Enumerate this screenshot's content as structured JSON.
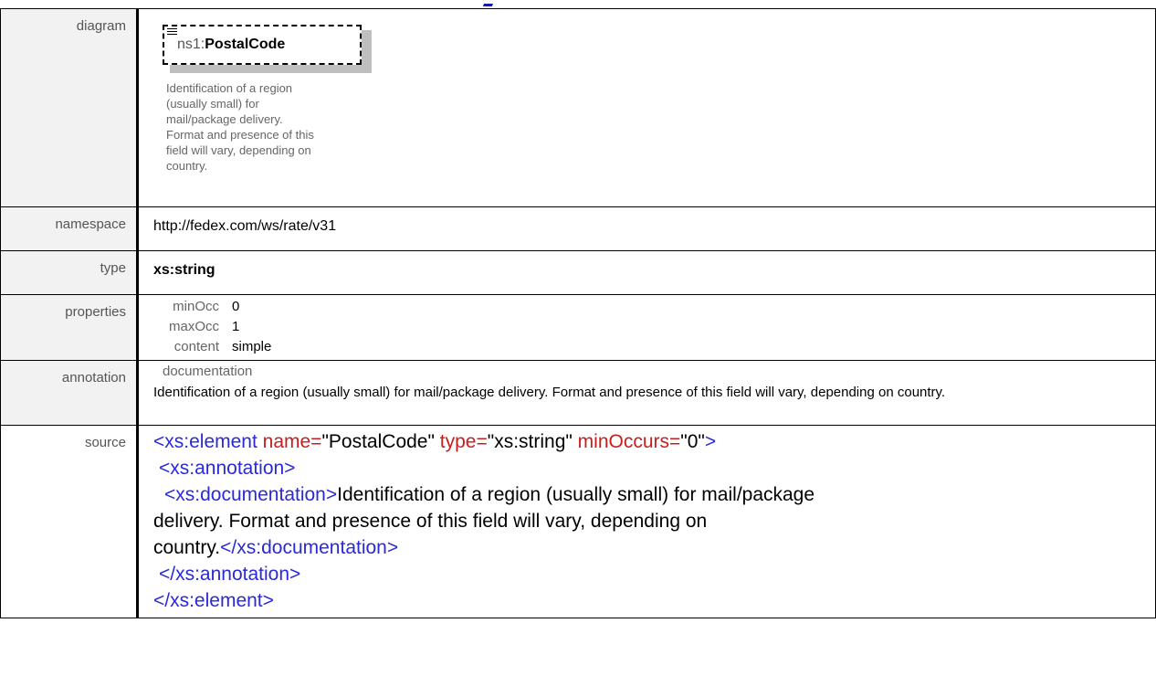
{
  "rows": {
    "diagram": {
      "label": "diagram"
    },
    "namespace": {
      "label": "namespace",
      "value": "http://fedex.com/ws/rate/v31"
    },
    "type": {
      "label": "type",
      "value": "xs:string"
    },
    "properties": {
      "label": "properties",
      "items": [
        {
          "key": "minOcc",
          "value": "0"
        },
        {
          "key": "maxOcc",
          "value": "1"
        },
        {
          "key": "content",
          "value": "simple"
        }
      ]
    },
    "annotation": {
      "label": "annotation",
      "key": "documentation",
      "text": "Identification of a region (usually small) for mail/package delivery. Format and presence of this field will vary, depending on country."
    },
    "source": {
      "label": "source"
    }
  },
  "diagram": {
    "ns_prefix": "ns1:",
    "name": "PostalCode",
    "doc_lines": [
      "Identification of a region",
      "(usually small) for",
      "mail/package delivery.",
      "Format and presence of this",
      "field will vary, depending on",
      "country."
    ]
  },
  "source": {
    "line1": {
      "open": "<xs:element",
      "attr1": " name=",
      "val1": "\"PostalCode\"",
      "attr2": " type=",
      "val2": "\"xs:string\"",
      "attr3": " minOccurs=",
      "val3": "\"0\"",
      "close": ">"
    },
    "line2": "<xs:annotation>",
    "line3_open": "<xs:documentation>",
    "line3_text": "Identification of a region (usually small) for mail/package",
    "line4_text": "delivery. Format and presence of this field will vary, depending on",
    "line5_text": "country.",
    "line5_close": "</xs:documentation>",
    "line6": "</xs:annotation>",
    "line7": "</xs:element>"
  }
}
